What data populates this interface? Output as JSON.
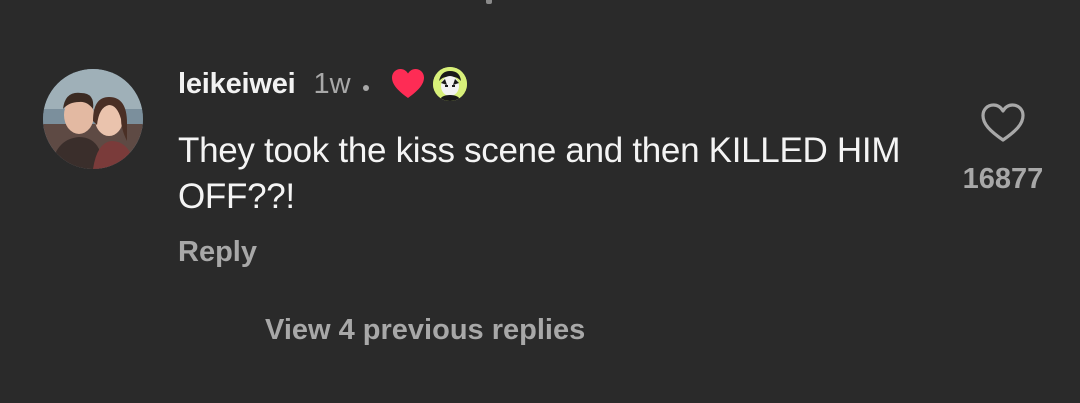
{
  "comment": {
    "username": "leikeiwei",
    "time": "1w",
    "text": "They took the kiss scene and then KILLED HIM OFF??!",
    "reply_label": "Reply",
    "like_count": "16877",
    "creator_liked": true
  },
  "thread": {
    "view_replies_label": "View 4 previous replies"
  },
  "icons": {
    "like": "heart-outline-icon",
    "creator_heart": "heart-filled-icon",
    "separator": "dot"
  },
  "colors": {
    "background": "#2a2a2a",
    "primary_text": "#f2f2f2",
    "secondary_text": "#a8a8a8",
    "creator_heart": "#fe2c55"
  }
}
